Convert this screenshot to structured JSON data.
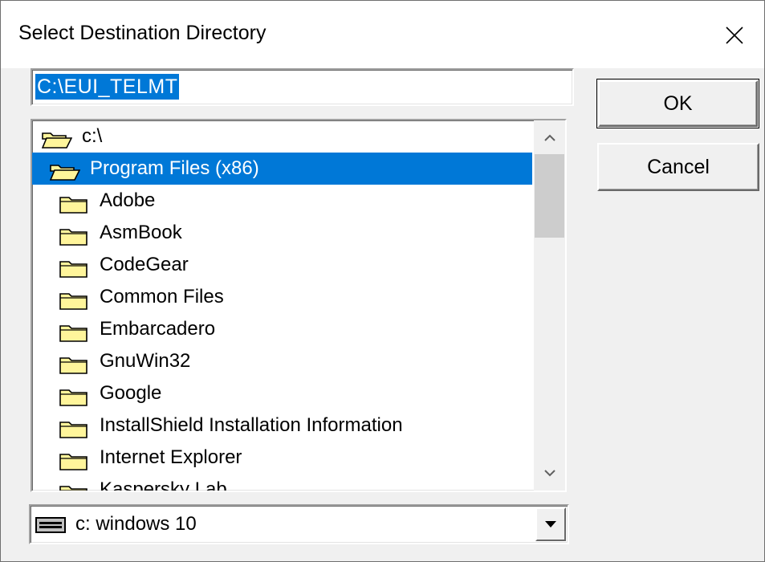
{
  "window": {
    "title": "Select Destination Directory"
  },
  "path_input": {
    "value": "C:\\EUI_TELMT"
  },
  "tree": {
    "items": [
      {
        "label": "c:\\",
        "level": 0,
        "icon": "open-folder-icon",
        "selected": false
      },
      {
        "label": "Program Files (x86)",
        "level": 1,
        "icon": "open-folder-icon",
        "selected": true
      },
      {
        "label": "Adobe",
        "level": 2,
        "icon": "folder-icon",
        "selected": false
      },
      {
        "label": "AsmBook",
        "level": 2,
        "icon": "folder-icon",
        "selected": false
      },
      {
        "label": "CodeGear",
        "level": 2,
        "icon": "folder-icon",
        "selected": false
      },
      {
        "label": "Common Files",
        "level": 2,
        "icon": "folder-icon",
        "selected": false
      },
      {
        "label": "Embarcadero",
        "level": 2,
        "icon": "folder-icon",
        "selected": false
      },
      {
        "label": "GnuWin32",
        "level": 2,
        "icon": "folder-icon",
        "selected": false
      },
      {
        "label": "Google",
        "level": 2,
        "icon": "folder-icon",
        "selected": false
      },
      {
        "label": "InstallShield Installation Information",
        "level": 2,
        "icon": "folder-icon",
        "selected": false
      },
      {
        "label": "Internet Explorer",
        "level": 2,
        "icon": "folder-icon",
        "selected": false
      },
      {
        "label": "Kaspersky Lab",
        "level": 2,
        "icon": "folder-icon",
        "selected": false
      }
    ]
  },
  "drive": {
    "value": "c:  windows 10",
    "icon": "drive-icon"
  },
  "buttons": {
    "ok": "OK",
    "cancel": "Cancel"
  },
  "colors": {
    "selection": "#0078d7",
    "folder": "#fff59b",
    "face": "#f0f0f0"
  }
}
